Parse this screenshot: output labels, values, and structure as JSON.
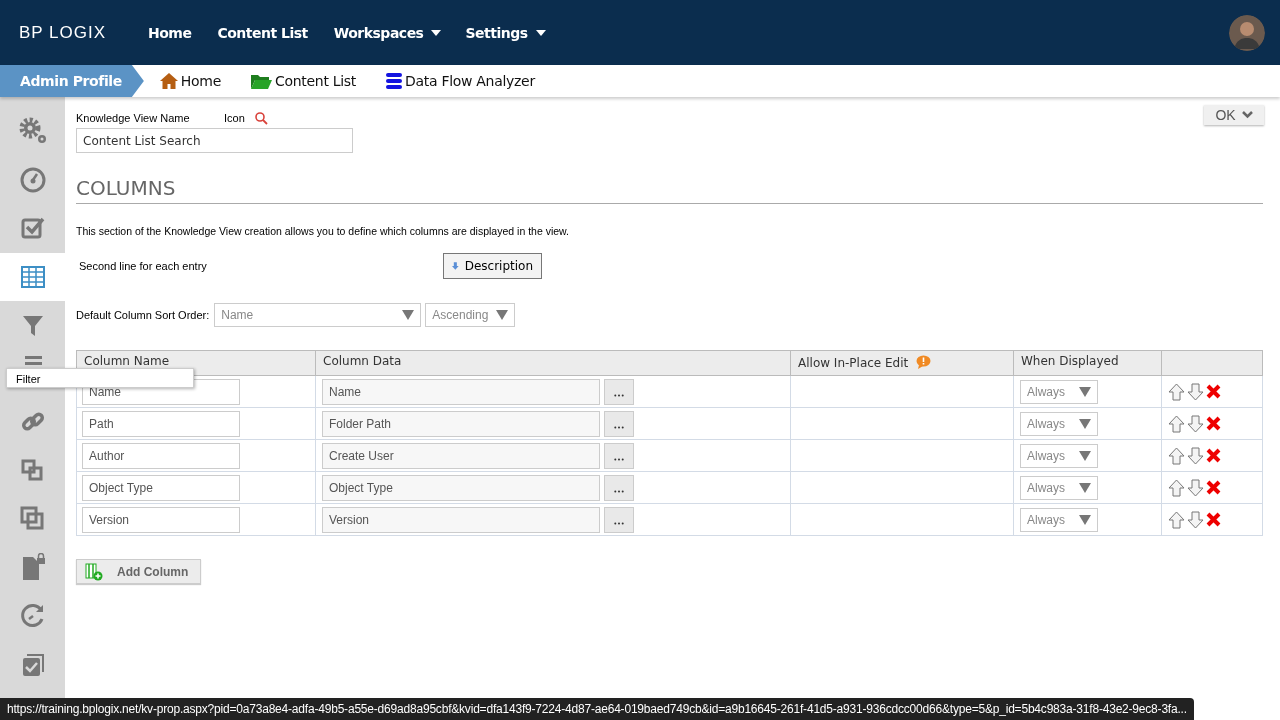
{
  "topbar": {
    "logo": "BP LOGIX",
    "nav": [
      {
        "label": "Home",
        "dropdown": false
      },
      {
        "label": "Content List",
        "dropdown": false
      },
      {
        "label": "Workspaces",
        "dropdown": true
      },
      {
        "label": "Settings",
        "dropdown": true
      }
    ]
  },
  "breadcrumb": {
    "profile": "Admin Profile",
    "links": [
      {
        "label": "Home",
        "kind": "home"
      },
      {
        "label": "Content List",
        "kind": "folder"
      },
      {
        "label": "Data Flow Analyzer",
        "kind": "database"
      }
    ]
  },
  "sidebar": {
    "items": [
      {
        "selected": false
      },
      {
        "selected": false
      },
      {
        "selected": false
      },
      {
        "selected": true
      },
      {
        "selected": false
      },
      {
        "selected": false
      },
      {
        "selected": false
      },
      {
        "selected": false
      },
      {
        "selected": false
      },
      {
        "selected": false
      },
      {
        "selected": false
      },
      {
        "selected": false
      }
    ],
    "tooltip": "Filter"
  },
  "ok_button": "OK",
  "form": {
    "name_label": "Knowledge View Name",
    "icon_label": "Icon",
    "name_value": "Content List Search"
  },
  "section": {
    "title": "COLUMNS",
    "intro": "This section of the Knowledge View creation allows you to define which columns are displayed in the view.",
    "second_line_label": "Second line for each entry",
    "second_line_button": "Description",
    "sort_label": "Default Column Sort Order:",
    "sort_field": "Name",
    "sort_direction": "Ascending"
  },
  "table": {
    "columns": [
      "Column Name",
      "Column Data",
      "Allow In-Place Edit",
      "When Displayed"
    ],
    "rows": [
      {
        "name": "Name",
        "data": "Name",
        "when": "Always"
      },
      {
        "name": "Path",
        "data": "Folder Path",
        "when": "Always"
      },
      {
        "name": "Author",
        "data": "Create User",
        "when": "Always"
      },
      {
        "name": "Object Type",
        "data": "Object Type",
        "when": "Always"
      },
      {
        "name": "Version",
        "data": "Version",
        "when": "Always"
      }
    ]
  },
  "add_button": "Add Column",
  "status_url": "https://training.bplogix.net/kv-prop.aspx?pid=0a73a8e4-adfa-49b5-a55e-d69ad8a95cbf&kvid=dfa143f9-7224-4d87-ae64-019baed749cb&id=a9b16645-261f-41d5-a931-936cdcc00d66&type=5&p_id=5b4c983a-31f8-43e2-9ec8-3fa..."
}
